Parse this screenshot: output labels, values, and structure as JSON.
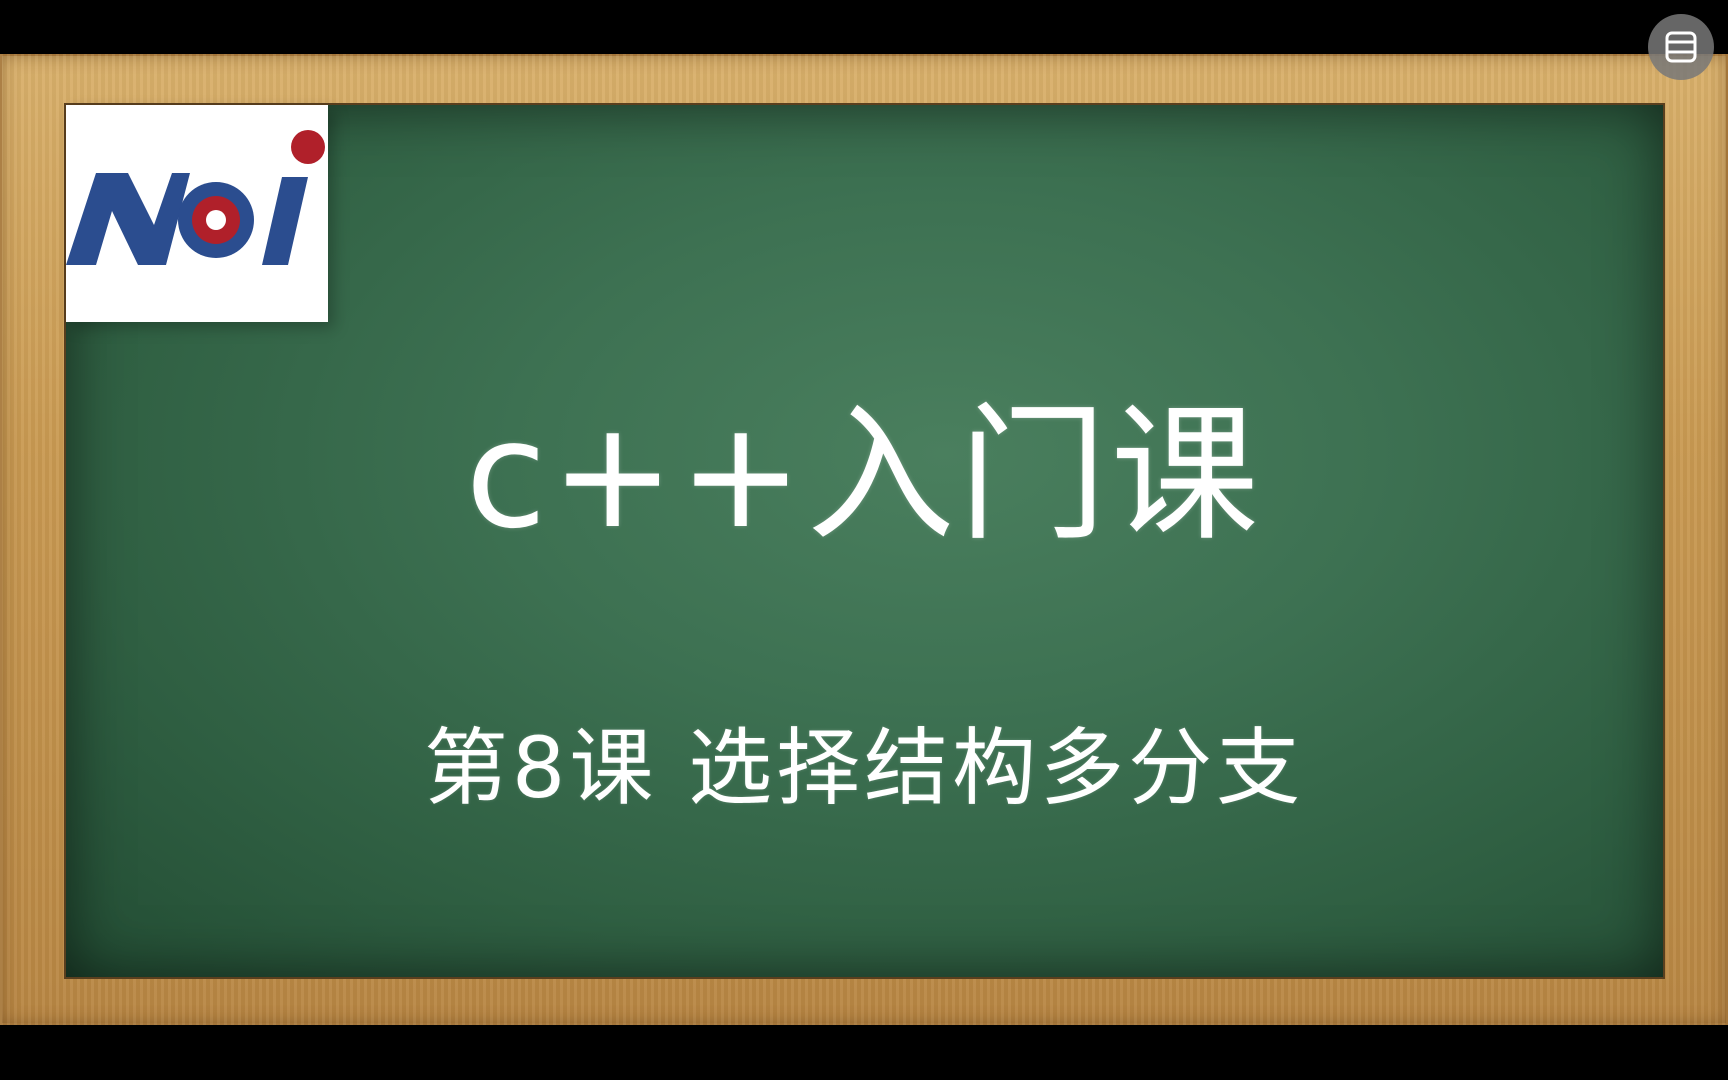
{
  "slide": {
    "title": "c++入门课",
    "subtitle": "第8课 选择结构多分支"
  },
  "logo": {
    "text": "NOI",
    "colors": {
      "letters": "#2b4d8f",
      "accent": "#b0202a"
    }
  },
  "controls": {
    "layout_button_icon": "window-layout-icon"
  },
  "colors": {
    "background": "#000000",
    "chalkboard": "#3d7152",
    "frame": "#c99a52",
    "text": "#ffffff"
  }
}
